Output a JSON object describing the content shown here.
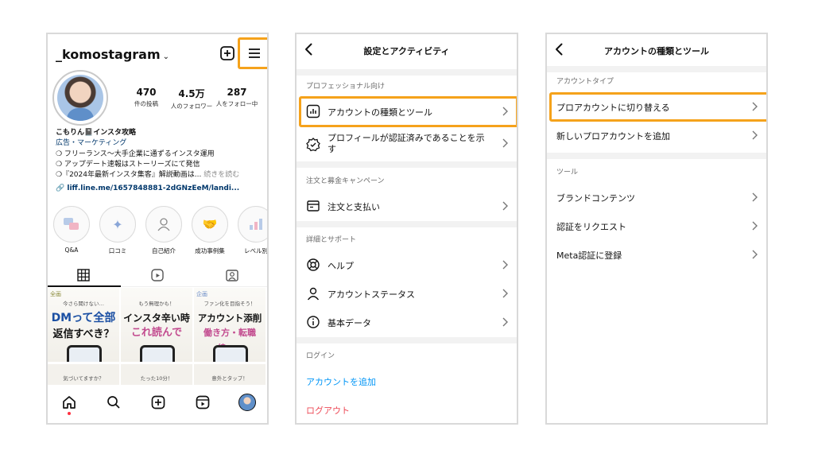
{
  "panel1": {
    "username": "_komostagram",
    "stats": [
      {
        "value": "470",
        "label": "件の投稿"
      },
      {
        "value": "4.5万",
        "label": "人のフォロワー"
      },
      {
        "value": "287",
        "label": "人をフォロー中"
      }
    ],
    "bio": {
      "name": "こもりん📓インスタ攻略",
      "category": "広告・マーケティング",
      "lines": [
        "❍ フリーランス〜大手企業に通ずるインスタ運用",
        "❍ アップデート速報はストーリーズにて発信",
        "❍『2024年最新インスタ集客』解説動画は..."
      ],
      "more": " 続きを読む",
      "link": "liff.line.me/1657848881-2dGNzEeM/landi..."
    },
    "highlights": [
      {
        "label": "Q&A",
        "icon": "qa-icon"
      },
      {
        "label": "口コミ",
        "icon": "sparkle-icon"
      },
      {
        "label": "自己紹介",
        "icon": "person-icon"
      },
      {
        "label": "成功事例集",
        "icon": "handshake-icon"
      },
      {
        "label": "レベル別",
        "icon": "chart-icon"
      }
    ],
    "posts": [
      {
        "tag": "全画",
        "sub": "今さら聞けない…",
        "big1": "DMって全部",
        "big2": "返信すべき？",
        "color1": "#1b4fa3",
        "color2": "#111111"
      },
      {
        "tag": "",
        "sub": "もう無理かも！",
        "big1": "インスタ辛い時",
        "big2": "これ読んで",
        "color1": "#111111",
        "color2": "#c24b8f"
      },
      {
        "tag": "企画",
        "sub": "ファン化を目指そう！",
        "big1": "アカウント添削",
        "big2": "働き方・転職",
        "color1": "#111111",
        "color2": "#c24b8f"
      }
    ],
    "posts2": [
      {
        "sub": "気づいてますか？"
      },
      {
        "sub": "たった10分！"
      },
      {
        "sub": "意外とタップ！"
      }
    ],
    "posts_extra": {
      "hen": "編"
    }
  },
  "panel2": {
    "title": "設定とアクティビティ",
    "sections": {
      "pro": "プロフェッショナル向け",
      "orders": "注文と募金キャンペーン",
      "details": "詳細とサポート",
      "login": "ログイン"
    },
    "rows": {
      "account_type": "アカウントの種類とツール",
      "verified": "プロフィールが認証済みであることを示す",
      "orders_payments": "注文と支払い",
      "help": "ヘルプ",
      "account_status": "アカウントステータス",
      "basic_data": "基本データ"
    },
    "add_account": "アカウントを追加",
    "logout": "ログアウト",
    "colors": {
      "add_account": "#0095f6",
      "logout": "#ed4956"
    }
  },
  "panel3": {
    "title": "アカウントの種類とツール",
    "sections": {
      "account_type": "アカウントタイプ",
      "tools": "ツール"
    },
    "rows": {
      "switch_pro": "プロアカウントに切り替える",
      "add_pro": "新しいプロアカウントを追加",
      "branded": "ブランドコンテンツ",
      "request_verify": "認証をリクエスト",
      "meta_verify": "Meta認証に登録"
    }
  },
  "highlight_color": "#f5a21b"
}
